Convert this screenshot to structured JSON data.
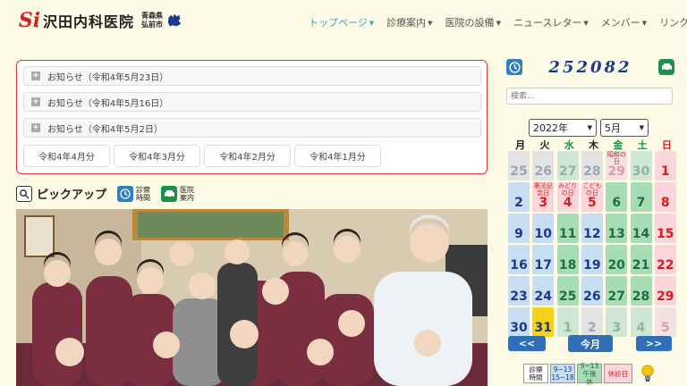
{
  "header": {
    "logo_mark": "Si",
    "logo_text": "沢田内科医院",
    "logo_sub_1": "青森県",
    "logo_sub_2": "弘前市",
    "nav": [
      {
        "label": "トップページ",
        "active": true,
        "caret": true
      },
      {
        "label": "診療案内",
        "active": false,
        "caret": true
      },
      {
        "label": "医院の設備",
        "active": false,
        "caret": true
      },
      {
        "label": "ニュースレター",
        "active": false,
        "caret": true
      },
      {
        "label": "メンバー",
        "active": false,
        "caret": true
      },
      {
        "label": "リンク集",
        "active": false,
        "caret": false
      }
    ]
  },
  "notices": {
    "items": [
      {
        "label": "お知らせ（令和4年5月23日）"
      },
      {
        "label": "お知らせ（令和4年5月16日）"
      },
      {
        "label": "お知らせ（令和4年5月2日）"
      }
    ],
    "archives": [
      "令和4年4月分",
      "令和4年3月分",
      "令和4年2月分",
      "令和4年1月分"
    ]
  },
  "pickup": {
    "title": "ピックアップ",
    "links": [
      {
        "line1": "診察",
        "line2": "時間",
        "icon": "clock-icon",
        "color": "#2e7fc7"
      },
      {
        "line1": "医院",
        "line2": "案内",
        "icon": "car-icon",
        "color": "#1f8f4e"
      }
    ]
  },
  "sidebar": {
    "counter": "252082",
    "search_placeholder": "検索...",
    "year": "2022年",
    "month": "5月",
    "weekdays": [
      "月",
      "火",
      "水",
      "木",
      "金",
      "土",
      "日"
    ],
    "weekday_colors": [
      "#222",
      "#222",
      "#1f8f4e",
      "#222",
      "#1f8f4e",
      "#1f8f4e",
      "#d81b1b"
    ],
    "colors": {
      "weekday_bg": "#c9ddf0",
      "weekday_fg": "#1d3a8a",
      "halfday_bg": "#a8dcb5",
      "halfday_fg": "#1f6f3e",
      "holiday_bg": "#fbd5dc",
      "holiday_fg": "#d81b1b",
      "today_bg": "#f4d21a",
      "muted_bg": "#e3e3e3"
    },
    "weeks": [
      [
        {
          "d": "25",
          "t": "m-w"
        },
        {
          "d": "26",
          "t": "m-w"
        },
        {
          "d": "27",
          "t": "m-h"
        },
        {
          "d": "28",
          "t": "m-w"
        },
        {
          "d": "29",
          "t": "m-hol",
          "note": "昭和の日"
        },
        {
          "d": "30",
          "t": "m-h"
        },
        {
          "d": "1",
          "t": "hol"
        }
      ],
      [
        {
          "d": "2",
          "t": "w"
        },
        {
          "d": "3",
          "t": "hol",
          "note": "憲法記念日"
        },
        {
          "d": "4",
          "t": "hol",
          "note": "みどりの日"
        },
        {
          "d": "5",
          "t": "hol",
          "note": "こどもの日"
        },
        {
          "d": "6",
          "t": "h"
        },
        {
          "d": "7",
          "t": "h"
        },
        {
          "d": "8",
          "t": "hol"
        }
      ],
      [
        {
          "d": "9",
          "t": "w"
        },
        {
          "d": "10",
          "t": "w"
        },
        {
          "d": "11",
          "t": "h"
        },
        {
          "d": "12",
          "t": "w"
        },
        {
          "d": "13",
          "t": "h"
        },
        {
          "d": "14",
          "t": "h"
        },
        {
          "d": "15",
          "t": "hol"
        }
      ],
      [
        {
          "d": "16",
          "t": "w"
        },
        {
          "d": "17",
          "t": "w"
        },
        {
          "d": "18",
          "t": "h"
        },
        {
          "d": "19",
          "t": "w"
        },
        {
          "d": "20",
          "t": "h"
        },
        {
          "d": "21",
          "t": "h"
        },
        {
          "d": "22",
          "t": "hol"
        }
      ],
      [
        {
          "d": "23",
          "t": "w"
        },
        {
          "d": "24",
          "t": "w"
        },
        {
          "d": "25",
          "t": "h"
        },
        {
          "d": "26",
          "t": "w"
        },
        {
          "d": "27",
          "t": "h"
        },
        {
          "d": "28",
          "t": "h"
        },
        {
          "d": "29",
          "t": "hol"
        }
      ],
      [
        {
          "d": "30",
          "t": "w"
        },
        {
          "d": "31",
          "t": "today"
        },
        {
          "d": "1",
          "t": "m-h"
        },
        {
          "d": "2",
          "t": "m-w"
        },
        {
          "d": "3",
          "t": "m-h"
        },
        {
          "d": "4",
          "t": "m-h"
        },
        {
          "d": "5",
          "t": "m-hol"
        }
      ]
    ],
    "nav": {
      "prev": "<<",
      "today": "今月",
      "next": ">>"
    },
    "legend": [
      {
        "text1": "診療",
        "text2": "時間",
        "bg": "#ffffff",
        "fg": "#222"
      },
      {
        "text1": "9~13",
        "text2": "15~18",
        "bg": "#c9ddf0",
        "fg": "#1d3a8a"
      },
      {
        "text1": "9~13",
        "text2": "午後休",
        "bg": "#a8dcb5",
        "fg": "#1f6f3e"
      },
      {
        "text1": "休診日",
        "text2": "",
        "bg": "#fbd5dc",
        "fg": "#d81b1b"
      }
    ]
  }
}
